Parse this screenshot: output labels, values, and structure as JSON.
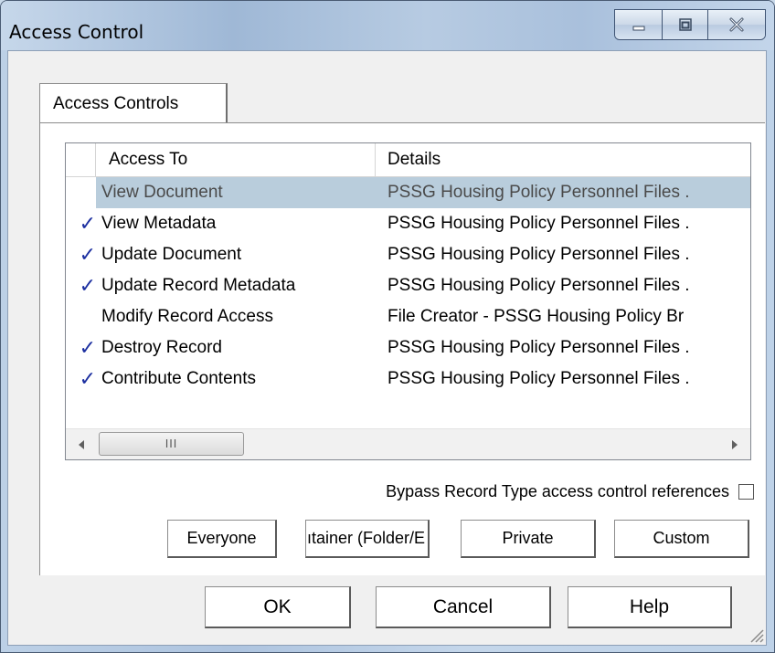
{
  "window": {
    "title": "Access Control"
  },
  "tabs": [
    {
      "label": "Access Controls"
    }
  ],
  "list": {
    "columns": {
      "access": "Access To",
      "details": "Details"
    },
    "rows": [
      {
        "checked": "",
        "access": "View Document",
        "details": "PSSG Housing Policy Personnel Files ."
      },
      {
        "checked": "✓",
        "access": "View Metadata",
        "details": "PSSG Housing Policy Personnel Files ."
      },
      {
        "checked": "✓",
        "access": "Update Document",
        "details": "PSSG Housing Policy Personnel Files ."
      },
      {
        "checked": "✓",
        "access": "Update Record Metadata",
        "details": "PSSG Housing Policy Personnel Files ."
      },
      {
        "checked": "",
        "access": "Modify Record Access",
        "details": "File Creator - PSSG Housing Policy Br"
      },
      {
        "checked": "✓",
        "access": "Destroy Record",
        "details": "PSSG Housing Policy Personnel Files ."
      },
      {
        "checked": "✓",
        "access": "Contribute Contents",
        "details": "PSSG Housing Policy Personnel Files ."
      }
    ],
    "scroll_thumb_glyph": "III"
  },
  "bypass": {
    "label": "Bypass Record Type access control references"
  },
  "preset_buttons": {
    "everyone": "Everyone",
    "container": "ıtainer (Folder/E",
    "private": "Private",
    "custom": "Custom"
  },
  "dialog_buttons": {
    "ok": "OK",
    "cancel": "Cancel",
    "help": "Help"
  },
  "icons": {
    "minimize": "minimize-icon",
    "maximize": "maximize-icon",
    "close": "close-icon",
    "scroll_left": "scroll-left-arrow-icon",
    "scroll_right": "scroll-right-arrow-icon",
    "resize_grip": "resize-grip-icon"
  }
}
